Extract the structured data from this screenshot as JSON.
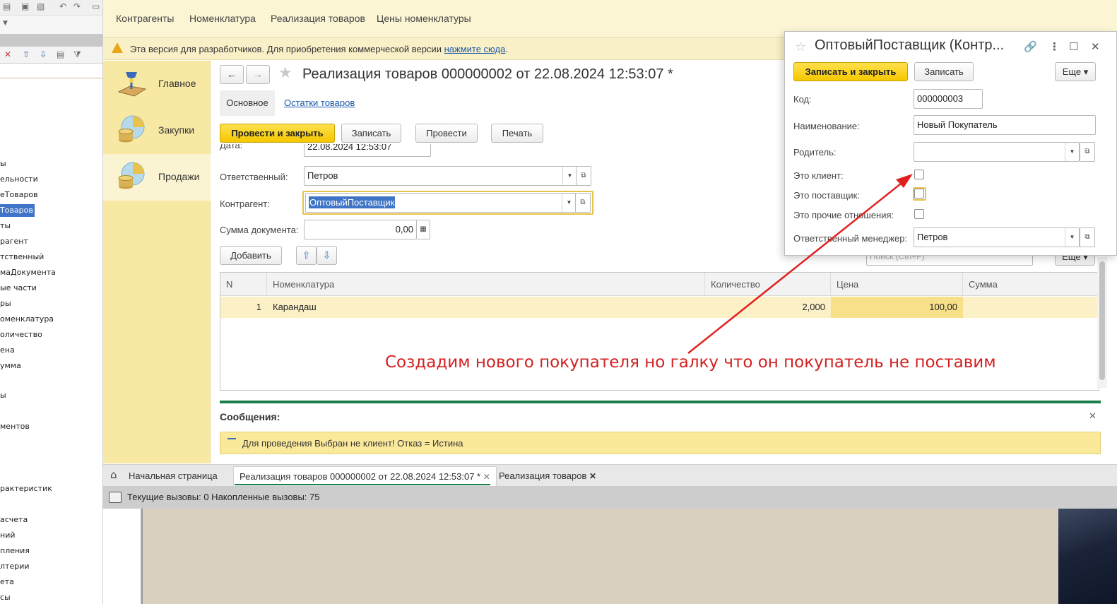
{
  "left_panel": {
    "items": [
      "ы",
      "ельности",
      "еТоваров",
      "Товаров",
      "ты",
      "рагент",
      "тственный",
      "маДокумента",
      "ые части",
      "ры",
      "оменклатура",
      "оличество",
      "ена",
      "умма",
      "ы",
      "ментов",
      "рактеристик",
      "асчета",
      "ний",
      "пления",
      "лтерии",
      "ета",
      "сы"
    ],
    "selected_item": "Товаров"
  },
  "top_nav": [
    "Контрагенты",
    "Номенклатура",
    "Реализация товаров",
    "Цены номенклатуры"
  ],
  "dev_notice": {
    "text": "Эта версия для разработчиков. Для приобретения коммерческой версии ",
    "link": "нажмите сюда",
    "suffix": "."
  },
  "sections": [
    {
      "label": "Главное",
      "icon": "desk-lamp-icon"
    },
    {
      "label": "Закупки",
      "icon": "coins-chart-icon"
    },
    {
      "label": "Продажи",
      "icon": "coins-chart-icon"
    }
  ],
  "document": {
    "title": "Реализация товаров 000000002 от 22.08.2024 12:53:07 *",
    "tabs": [
      "Основное",
      "Остатки товаров"
    ],
    "buttons": {
      "post_close": "Провести и закрыть",
      "save": "Записать",
      "post": "Провести",
      "print": "Печать"
    },
    "date_label": "Дата:",
    "date_value": "22.08.2024 12:53:07",
    "responsible_label": "Ответственный:",
    "responsible_value": "Петров",
    "counterparty_label": "Контрагент:",
    "counterparty_value": "ОптовыйПоставщик",
    "sum_label": "Сумма документа:",
    "sum_value": "0,00",
    "add_button": "Добавить",
    "search_placeholder": "Поиск (Ctrl+F)",
    "more_button": "Еще"
  },
  "table": {
    "columns": [
      "N",
      "Номенклатура",
      "Количество",
      "Цена",
      "Сумма"
    ],
    "rows": [
      {
        "n": "1",
        "item": "Карандаш",
        "qty": "2,000",
        "price": "100,00",
        "sum": ""
      }
    ]
  },
  "messages": {
    "title": "Сообщения:",
    "items": [
      "Для проведения Выбран не клиент! Отказ = Истина"
    ]
  },
  "tabs_bottom": {
    "home": "Начальная страница",
    "open": [
      "Реализация товаров 000000002 от 22.08.2024 12:53:07 *",
      "Реализация товаров"
    ]
  },
  "status": {
    "text": "Текущие вызовы: 0   Накопленные вызовы: 75"
  },
  "popup": {
    "title": "ОптовыйПоставщик (Контр...",
    "buttons": {
      "save_close": "Записать и закрыть",
      "save": "Записать",
      "more": "Еще"
    },
    "code_label": "Код:",
    "code_value": "000000003",
    "name_label": "Наименование:",
    "name_value": "Новый Покупатель",
    "parent_label": "Родитель:",
    "parent_value": "",
    "is_client_label": "Это клиент:",
    "is_client": false,
    "is_supplier_label": "Это поставщик:",
    "is_supplier": false,
    "is_other_label": "Это прочие отношения:",
    "is_other": false,
    "manager_label": "Ответственный менеджер:",
    "manager_value": "Петров"
  },
  "annotation": {
    "text": "Создадим нового покупателя но галку что он покупатель не поставим",
    "color": "#d42020"
  },
  "colors": {
    "primary_button": "#f5c800",
    "accent_green": "#1a7d4a",
    "link": "#1a57a8"
  }
}
